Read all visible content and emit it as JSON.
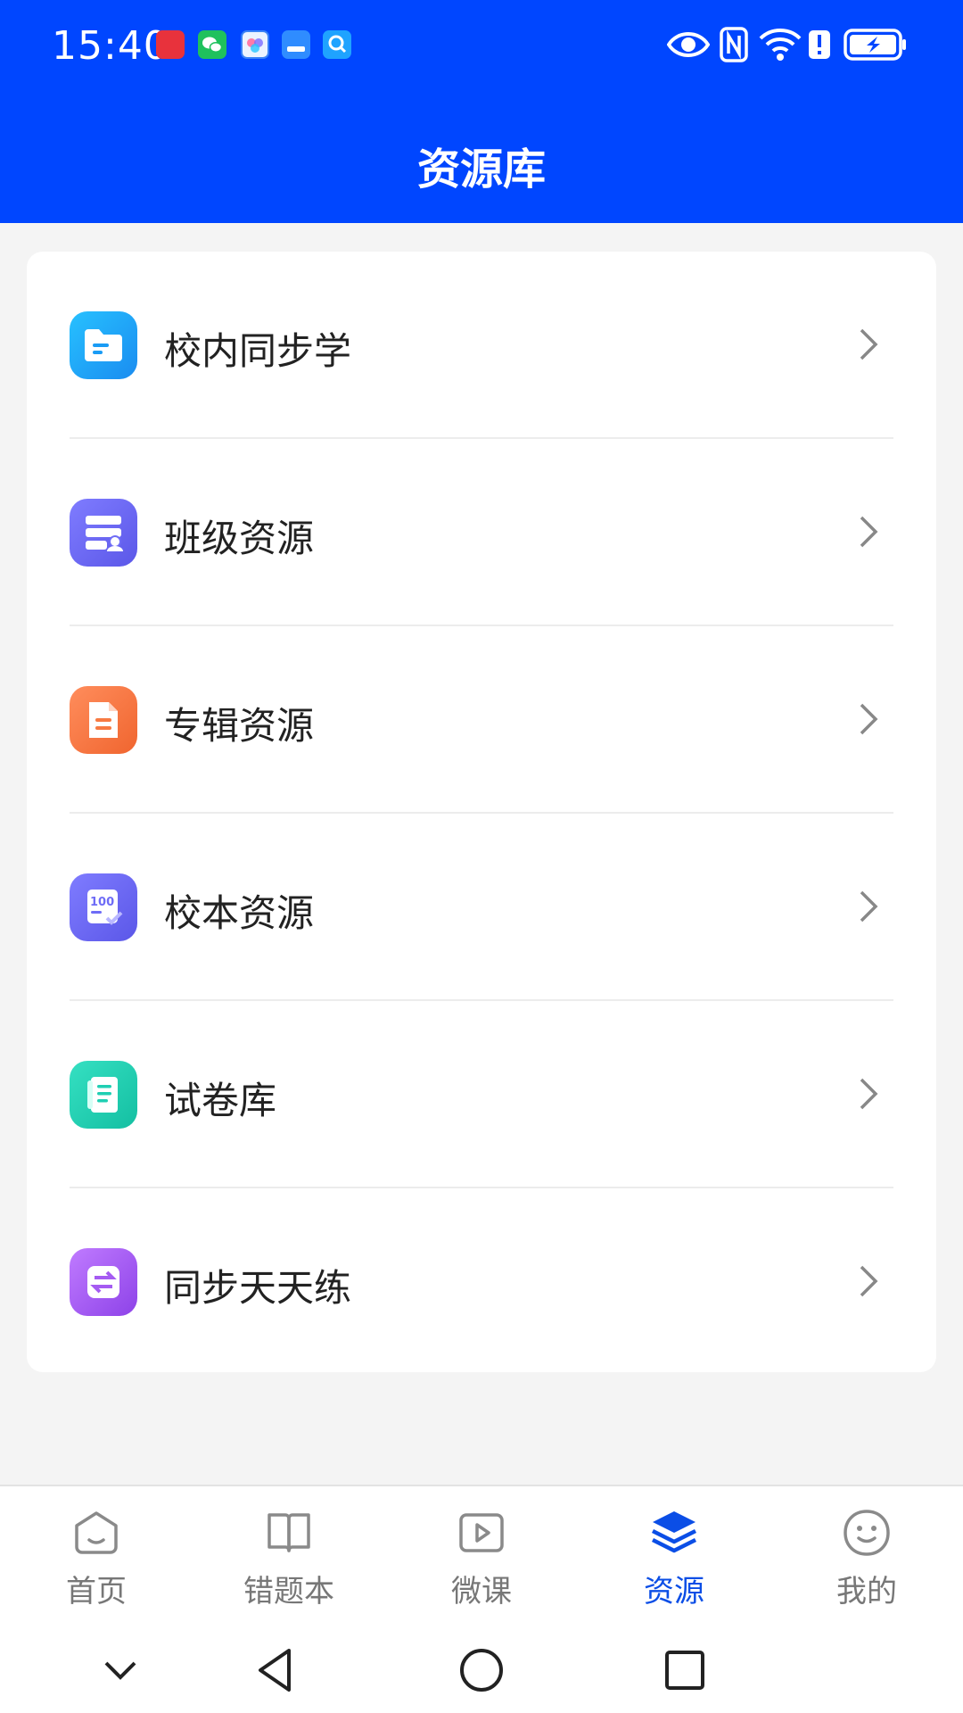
{
  "status_bar": {
    "time": "15:40",
    "notification_icons": [
      "huawei-icon",
      "wechat-icon",
      "gallery-app-icon",
      "reader-app-icon",
      "search-app-icon"
    ],
    "system_icons": [
      "eye-icon",
      "nfc-icon",
      "wifi-icon",
      "alert-icon",
      "battery-charging-icon"
    ]
  },
  "header": {
    "title": "资源库"
  },
  "menu": {
    "items": [
      {
        "label": "校内同步学",
        "icon": "folder-icon",
        "color": "#1aa6f5"
      },
      {
        "label": "班级资源",
        "icon": "class-resource-icon",
        "color": "#6e6cf6"
      },
      {
        "label": "专辑资源",
        "icon": "document-icon",
        "color": "#f77a43"
      },
      {
        "label": "校本资源",
        "icon": "score-100-icon",
        "color": "#6e6cf6"
      },
      {
        "label": "试卷库",
        "icon": "exam-paper-icon",
        "color": "#1fcfb3"
      },
      {
        "label": "同步天天练",
        "icon": "sync-arrows-icon",
        "color": "#a55bf2"
      }
    ]
  },
  "bottom_nav": {
    "tabs": [
      {
        "label": "首页",
        "icon": "home-icon"
      },
      {
        "label": "错题本",
        "icon": "book-icon"
      },
      {
        "label": "微课",
        "icon": "play-icon"
      },
      {
        "label": "资源",
        "icon": "layers-icon",
        "active": true
      },
      {
        "label": "我的",
        "icon": "smile-icon"
      }
    ]
  },
  "colors": {
    "primary": "#0046ff",
    "active_tab": "#0b4ee6"
  }
}
